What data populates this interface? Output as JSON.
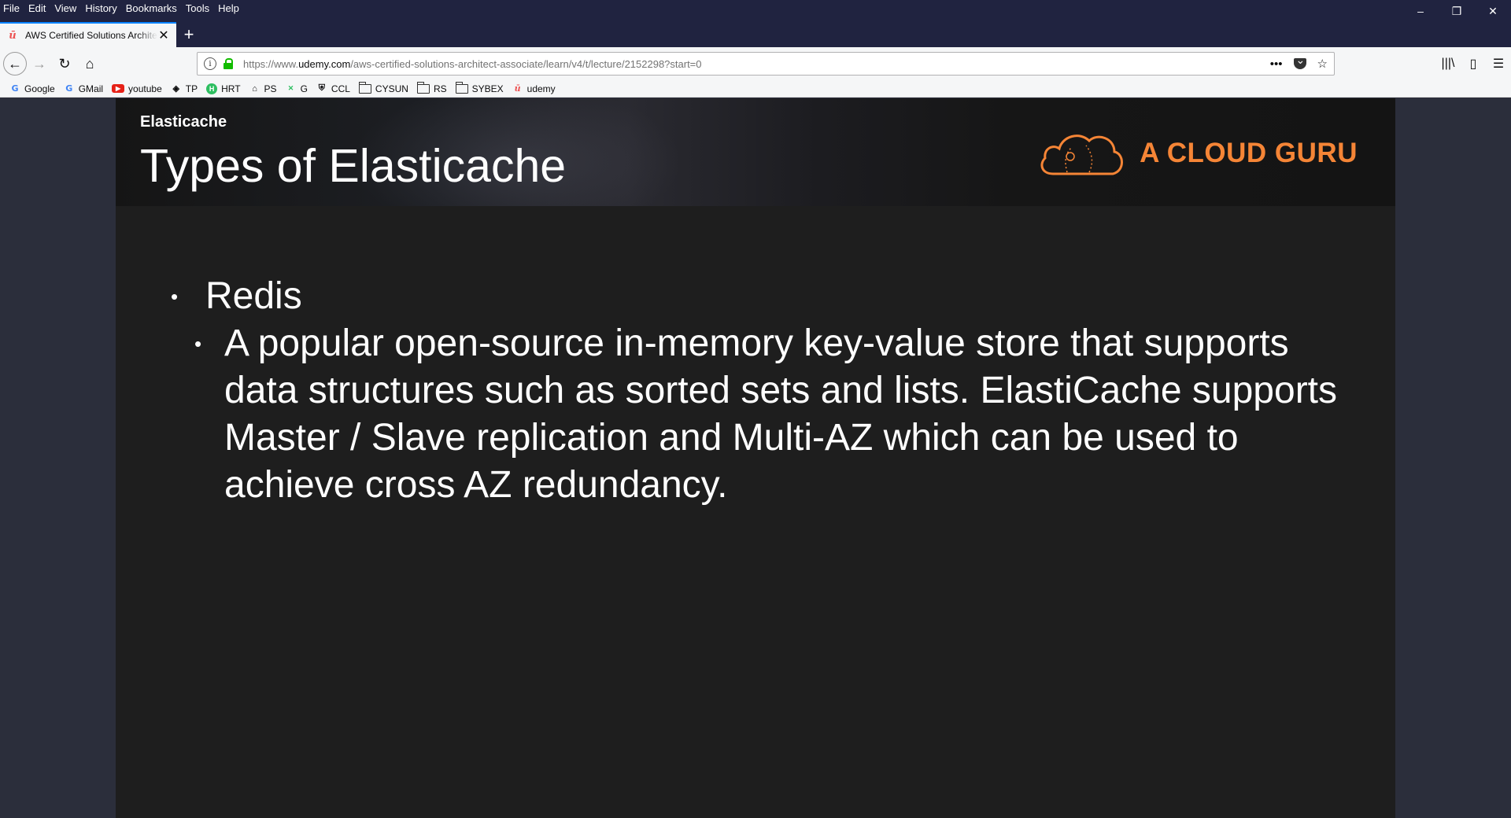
{
  "menu": [
    "File",
    "Edit",
    "View",
    "History",
    "Bookmarks",
    "Tools",
    "Help"
  ],
  "window_controls": {
    "minimize": "–",
    "restore": "❐",
    "close": "✕"
  },
  "tab": {
    "title": "AWS Certified Solutions Architect",
    "favicon": "ū",
    "close": "✕",
    "new_tab": "+"
  },
  "nav": {
    "back": "←",
    "forward": "→",
    "reload": "↻",
    "home": "⌂"
  },
  "url": {
    "info": "i",
    "prefix": "https://www.",
    "host": "udemy.com",
    "path": "/aws-certified-solutions-architect-associate/learn/v4/t/lecture/2152298?start=0",
    "more": "•••",
    "star": "☆"
  },
  "toolbar_right": {
    "library": "|||\\",
    "sidebar": "▯",
    "menu": "☰"
  },
  "bookmarks": [
    {
      "label": "Google",
      "icon": "google-icon",
      "glyph": "G"
    },
    {
      "label": "GMail",
      "icon": "google-icon",
      "glyph": "G"
    },
    {
      "label": "youtube",
      "icon": "youtube-icon",
      "glyph": "▶"
    },
    {
      "label": "TP",
      "icon": "tp-icon",
      "glyph": "◈"
    },
    {
      "label": "HRT",
      "icon": "hackerrank-icon",
      "glyph": "H"
    },
    {
      "label": "PS",
      "icon": "ps-icon",
      "glyph": "⌂"
    },
    {
      "label": "G",
      "icon": "g-icon",
      "glyph": "✕"
    },
    {
      "label": "CCL",
      "icon": "ccl-icon",
      "glyph": "⛨"
    },
    {
      "label": "CYSUN",
      "icon": "folder-icon",
      "glyph": ""
    },
    {
      "label": "RS",
      "icon": "folder-icon",
      "glyph": ""
    },
    {
      "label": "SYBEX",
      "icon": "folder-icon",
      "glyph": ""
    },
    {
      "label": "udemy",
      "icon": "udemy-icon",
      "glyph": "ū"
    }
  ],
  "slide": {
    "category": "Elasticache",
    "title": "Types of Elasticache",
    "logo_text": "A CLOUD GURU",
    "bullet1": "Redis",
    "bullet2": "A popular open-source in-memory key-value store that supports data structures such as sorted sets and lists. ElastiCache supports Master / Slave replication and Multi-AZ which can be used to achieve cross AZ redundancy."
  },
  "colors": {
    "accent": "#f58536",
    "chrome_dark": "#202340",
    "slide_bg": "#1e1e1e"
  }
}
